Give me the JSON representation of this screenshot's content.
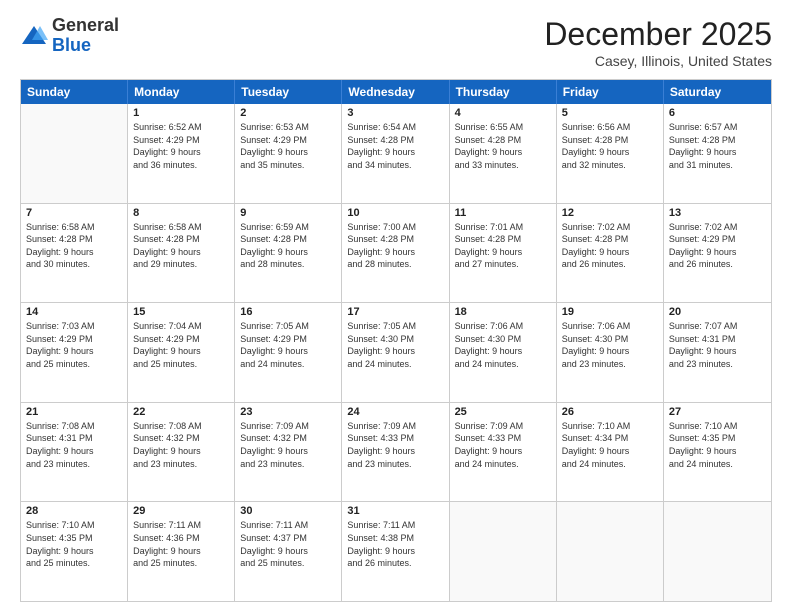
{
  "logo": {
    "general": "General",
    "blue": "Blue"
  },
  "title": "December 2025",
  "location": "Casey, Illinois, United States",
  "header": {
    "days": [
      "Sunday",
      "Monday",
      "Tuesday",
      "Wednesday",
      "Thursday",
      "Friday",
      "Saturday"
    ]
  },
  "weeks": [
    [
      {
        "day": "",
        "sunrise": "",
        "sunset": "",
        "daylight": ""
      },
      {
        "day": "1",
        "sunrise": "Sunrise: 6:52 AM",
        "sunset": "Sunset: 4:29 PM",
        "daylight": "Daylight: 9 hours and 36 minutes."
      },
      {
        "day": "2",
        "sunrise": "Sunrise: 6:53 AM",
        "sunset": "Sunset: 4:29 PM",
        "daylight": "Daylight: 9 hours and 35 minutes."
      },
      {
        "day": "3",
        "sunrise": "Sunrise: 6:54 AM",
        "sunset": "Sunset: 4:28 PM",
        "daylight": "Daylight: 9 hours and 34 minutes."
      },
      {
        "day": "4",
        "sunrise": "Sunrise: 6:55 AM",
        "sunset": "Sunset: 4:28 PM",
        "daylight": "Daylight: 9 hours and 33 minutes."
      },
      {
        "day": "5",
        "sunrise": "Sunrise: 6:56 AM",
        "sunset": "Sunset: 4:28 PM",
        "daylight": "Daylight: 9 hours and 32 minutes."
      },
      {
        "day": "6",
        "sunrise": "Sunrise: 6:57 AM",
        "sunset": "Sunset: 4:28 PM",
        "daylight": "Daylight: 9 hours and 31 minutes."
      }
    ],
    [
      {
        "day": "7",
        "sunrise": "Sunrise: 6:58 AM",
        "sunset": "Sunset: 4:28 PM",
        "daylight": "Daylight: 9 hours and 30 minutes."
      },
      {
        "day": "8",
        "sunrise": "Sunrise: 6:58 AM",
        "sunset": "Sunset: 4:28 PM",
        "daylight": "Daylight: 9 hours and 29 minutes."
      },
      {
        "day": "9",
        "sunrise": "Sunrise: 6:59 AM",
        "sunset": "Sunset: 4:28 PM",
        "daylight": "Daylight: 9 hours and 28 minutes."
      },
      {
        "day": "10",
        "sunrise": "Sunrise: 7:00 AM",
        "sunset": "Sunset: 4:28 PM",
        "daylight": "Daylight: 9 hours and 28 minutes."
      },
      {
        "day": "11",
        "sunrise": "Sunrise: 7:01 AM",
        "sunset": "Sunset: 4:28 PM",
        "daylight": "Daylight: 9 hours and 27 minutes."
      },
      {
        "day": "12",
        "sunrise": "Sunrise: 7:02 AM",
        "sunset": "Sunset: 4:28 PM",
        "daylight": "Daylight: 9 hours and 26 minutes."
      },
      {
        "day": "13",
        "sunrise": "Sunrise: 7:02 AM",
        "sunset": "Sunset: 4:29 PM",
        "daylight": "Daylight: 9 hours and 26 minutes."
      }
    ],
    [
      {
        "day": "14",
        "sunrise": "Sunrise: 7:03 AM",
        "sunset": "Sunset: 4:29 PM",
        "daylight": "Daylight: 9 hours and 25 minutes."
      },
      {
        "day": "15",
        "sunrise": "Sunrise: 7:04 AM",
        "sunset": "Sunset: 4:29 PM",
        "daylight": "Daylight: 9 hours and 25 minutes."
      },
      {
        "day": "16",
        "sunrise": "Sunrise: 7:05 AM",
        "sunset": "Sunset: 4:29 PM",
        "daylight": "Daylight: 9 hours and 24 minutes."
      },
      {
        "day": "17",
        "sunrise": "Sunrise: 7:05 AM",
        "sunset": "Sunset: 4:30 PM",
        "daylight": "Daylight: 9 hours and 24 minutes."
      },
      {
        "day": "18",
        "sunrise": "Sunrise: 7:06 AM",
        "sunset": "Sunset: 4:30 PM",
        "daylight": "Daylight: 9 hours and 24 minutes."
      },
      {
        "day": "19",
        "sunrise": "Sunrise: 7:06 AM",
        "sunset": "Sunset: 4:30 PM",
        "daylight": "Daylight: 9 hours and 23 minutes."
      },
      {
        "day": "20",
        "sunrise": "Sunrise: 7:07 AM",
        "sunset": "Sunset: 4:31 PM",
        "daylight": "Daylight: 9 hours and 23 minutes."
      }
    ],
    [
      {
        "day": "21",
        "sunrise": "Sunrise: 7:08 AM",
        "sunset": "Sunset: 4:31 PM",
        "daylight": "Daylight: 9 hours and 23 minutes."
      },
      {
        "day": "22",
        "sunrise": "Sunrise: 7:08 AM",
        "sunset": "Sunset: 4:32 PM",
        "daylight": "Daylight: 9 hours and 23 minutes."
      },
      {
        "day": "23",
        "sunrise": "Sunrise: 7:09 AM",
        "sunset": "Sunset: 4:32 PM",
        "daylight": "Daylight: 9 hours and 23 minutes."
      },
      {
        "day": "24",
        "sunrise": "Sunrise: 7:09 AM",
        "sunset": "Sunset: 4:33 PM",
        "daylight": "Daylight: 9 hours and 23 minutes."
      },
      {
        "day": "25",
        "sunrise": "Sunrise: 7:09 AM",
        "sunset": "Sunset: 4:33 PM",
        "daylight": "Daylight: 9 hours and 24 minutes."
      },
      {
        "day": "26",
        "sunrise": "Sunrise: 7:10 AM",
        "sunset": "Sunset: 4:34 PM",
        "daylight": "Daylight: 9 hours and 24 minutes."
      },
      {
        "day": "27",
        "sunrise": "Sunrise: 7:10 AM",
        "sunset": "Sunset: 4:35 PM",
        "daylight": "Daylight: 9 hours and 24 minutes."
      }
    ],
    [
      {
        "day": "28",
        "sunrise": "Sunrise: 7:10 AM",
        "sunset": "Sunset: 4:35 PM",
        "daylight": "Daylight: 9 hours and 25 minutes."
      },
      {
        "day": "29",
        "sunrise": "Sunrise: 7:11 AM",
        "sunset": "Sunset: 4:36 PM",
        "daylight": "Daylight: 9 hours and 25 minutes."
      },
      {
        "day": "30",
        "sunrise": "Sunrise: 7:11 AM",
        "sunset": "Sunset: 4:37 PM",
        "daylight": "Daylight: 9 hours and 25 minutes."
      },
      {
        "day": "31",
        "sunrise": "Sunrise: 7:11 AM",
        "sunset": "Sunset: 4:38 PM",
        "daylight": "Daylight: 9 hours and 26 minutes."
      },
      {
        "day": "",
        "sunrise": "",
        "sunset": "",
        "daylight": ""
      },
      {
        "day": "",
        "sunrise": "",
        "sunset": "",
        "daylight": ""
      },
      {
        "day": "",
        "sunrise": "",
        "sunset": "",
        "daylight": ""
      }
    ]
  ]
}
